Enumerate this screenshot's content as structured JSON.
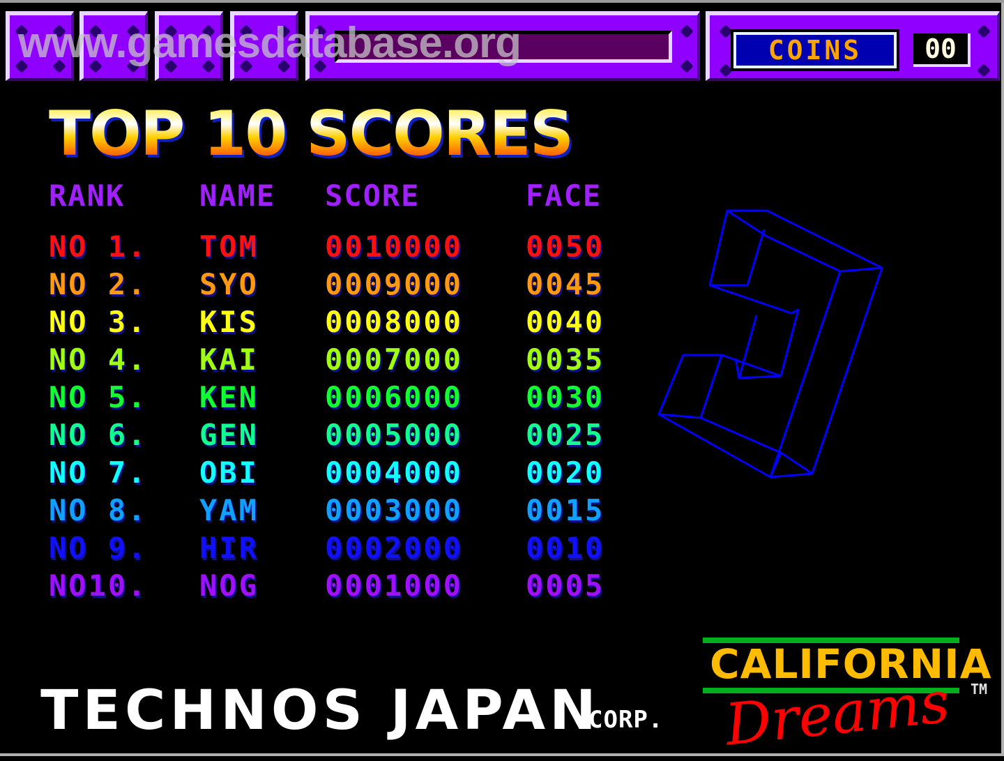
{
  "watermark": "www.gamesdatabase.org",
  "topbar": {
    "coins_label": "COINS",
    "coins_count": "00"
  },
  "title": "TOP 10 SCORES",
  "table": {
    "headers": {
      "rank": "RANK",
      "name": "NAME",
      "score": "SCORE",
      "face": "FACE"
    },
    "rows": [
      {
        "rank": "NO 1.",
        "name": "TOM",
        "score": "0010000",
        "face": "0050",
        "color": "#ff1010"
      },
      {
        "rank": "NO 2.",
        "name": "SYO",
        "score": "0009000",
        "face": "0045",
        "color": "#ff9a10"
      },
      {
        "rank": "NO 3.",
        "name": "KIS",
        "score": "0008000",
        "face": "0040",
        "color": "#ffff10"
      },
      {
        "rank": "NO 4.",
        "name": "KAI",
        "score": "0007000",
        "face": "0035",
        "color": "#a0ff10"
      },
      {
        "rank": "NO 5.",
        "name": "KEN",
        "score": "0006000",
        "face": "0030",
        "color": "#10ff30"
      },
      {
        "rank": "NO 6.",
        "name": "GEN",
        "score": "0005000",
        "face": "0025",
        "color": "#10ff90"
      },
      {
        "rank": "NO 7.",
        "name": "OBI",
        "score": "0004000",
        "face": "0020",
        "color": "#10ffff"
      },
      {
        "rank": "NO 8.",
        "name": "YAM",
        "score": "0003000",
        "face": "0015",
        "color": "#10a0ff"
      },
      {
        "rank": "NO 9.",
        "name": "HIR",
        "score": "0002000",
        "face": "0010",
        "color": "#1010ff"
      },
      {
        "rank": "NO10.",
        "name": "NOG",
        "score": "0001000",
        "face": "0005",
        "color": "#a010ff"
      }
    ]
  },
  "footer": {
    "publisher": "TECHNOS JAPAN",
    "publisher_suffix": "CORP.",
    "game_title_top": "CALIFORNIA",
    "game_title_bottom": "Dreams",
    "trademark": "TM"
  },
  "colors": {
    "panel_purple": "#8f00ff",
    "header_purple": "#a020ff",
    "wireframe_blue": "#0000ff",
    "coins_label": "#ffa500",
    "california_gold": "#ffbb00",
    "dreams_red": "#ff0000",
    "stripe_green": "#00b020"
  }
}
